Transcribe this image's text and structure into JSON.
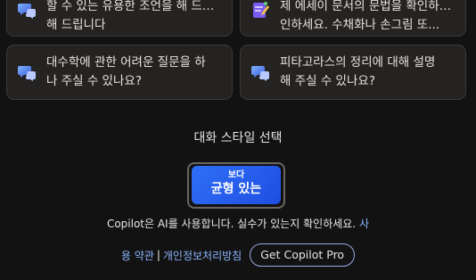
{
  "suggestions": [
    {
      "icon": "chat-bubbles-icon",
      "lines": [
        "할 수 있는 유용한 조언을 해 드립니",
        "해 드립니다"
      ]
    },
    {
      "icon": "pencil-pad-icon",
      "lines": [
        "제 에세이 문서의 문법을 확인하세요. 수",
        "인하세요. 수채화나 손그림 또..."
      ]
    },
    {
      "icon": "chat-bubbles-icon",
      "lines": [
        "대수학에 관한 어려운 질문을 하",
        "나 주실 수 있나요?"
      ]
    },
    {
      "icon": "chat-bubbles-icon",
      "lines": [
        "피타고라스의 정리에 대해 설명",
        "해 주실 수 있나요?"
      ]
    }
  ],
  "conversation_style": {
    "title": "대화 스타일 선택",
    "selected_small": "보다",
    "selected_big": "균형 있는"
  },
  "disclaimer": {
    "text": "Copilot은 AI를 사용합니다. 실수가 있는지 확인하세요.",
    "link_start": "사",
    "link_end": "용 약관"
  },
  "footer": {
    "separator": "|",
    "privacy": "개인정보처리방침",
    "pro_button": "Get Copilot Pro"
  }
}
